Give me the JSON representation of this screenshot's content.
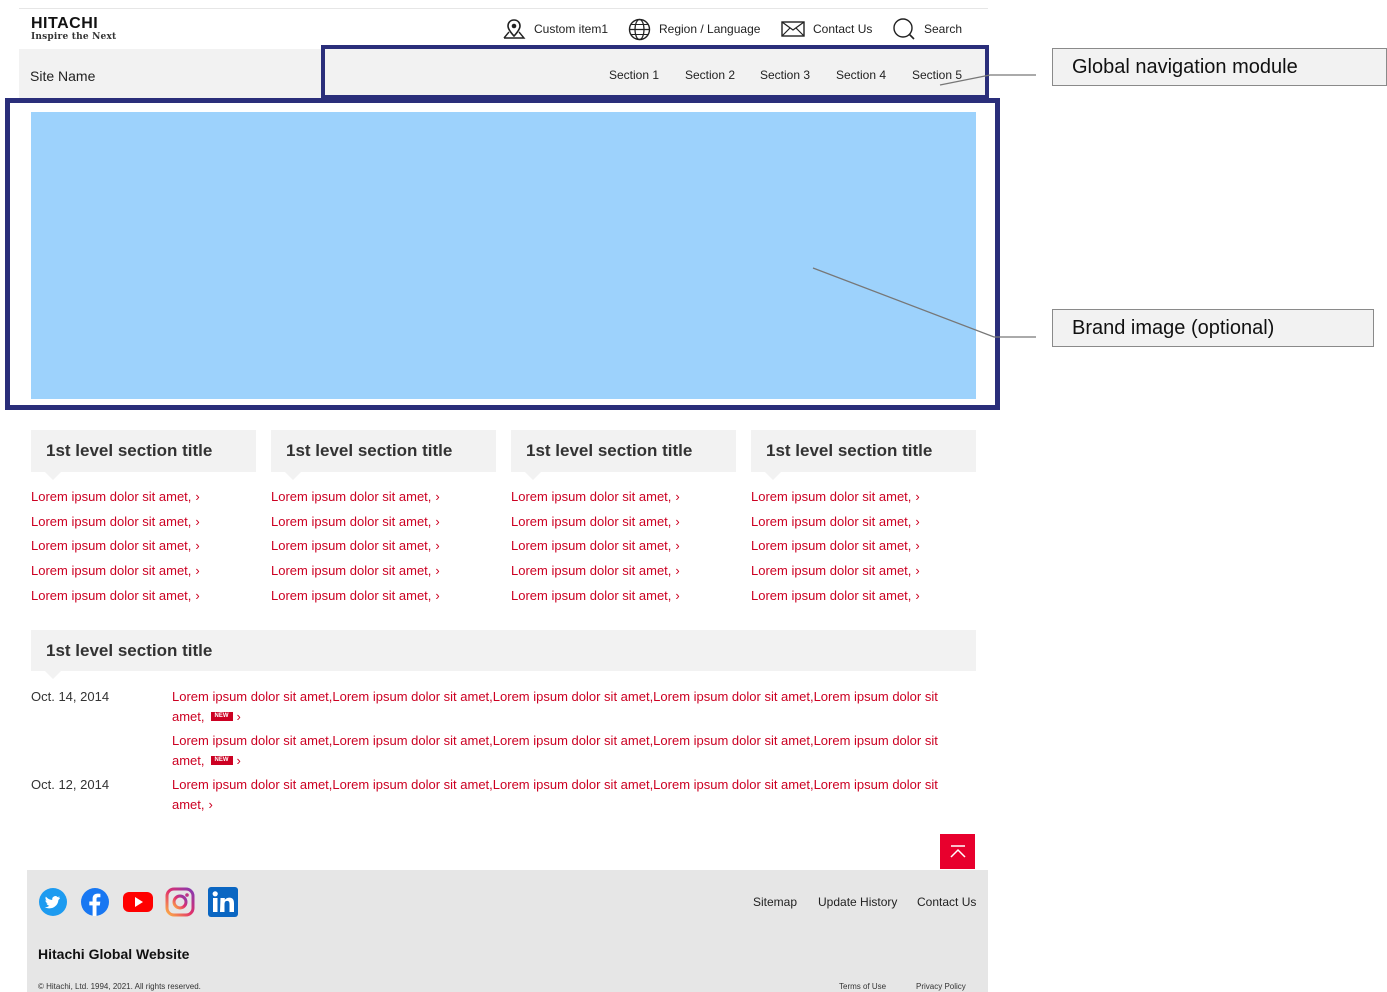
{
  "header": {
    "logo_main": "HITACHI",
    "logo_tagline": "Inspire the Next",
    "utility": {
      "custom_item": "Custom item1",
      "region_language": "Region / Language",
      "contact": "Contact Us",
      "search": "Search"
    },
    "site_name": "Site Name",
    "nav_sections": [
      "Section 1",
      "Section 2",
      "Section 3",
      "Section 4",
      "Section 5"
    ]
  },
  "annotations": {
    "global_nav": "Global navigation module",
    "brand_image": "Brand image (optional)"
  },
  "link_sections": [
    {
      "title": "1st level section title",
      "links": [
        "Lorem ipsum dolor sit amet,",
        "Lorem ipsum dolor sit amet,",
        "Lorem ipsum dolor sit amet,",
        "Lorem ipsum dolor sit amet,",
        "Lorem ipsum dolor sit amet,"
      ]
    },
    {
      "title": "1st level section title",
      "links": [
        "Lorem ipsum dolor sit amet,",
        "Lorem ipsum dolor sit amet,",
        "Lorem ipsum dolor sit amet,",
        "Lorem ipsum dolor sit amet,",
        "Lorem ipsum dolor sit amet,"
      ]
    },
    {
      "title": "1st level section title",
      "links": [
        "Lorem ipsum dolor sit amet,",
        "Lorem ipsum dolor sit amet,",
        "Lorem ipsum dolor sit amet,",
        "Lorem ipsum dolor sit amet,",
        "Lorem ipsum dolor sit amet,"
      ]
    },
    {
      "title": "1st level section title",
      "links": [
        "Lorem ipsum dolor sit amet,",
        "Lorem ipsum dolor sit amet,",
        "Lorem ipsum dolor sit amet,",
        "Lorem ipsum dolor sit amet,",
        "Lorem ipsum dolor sit amet,"
      ]
    }
  ],
  "news": {
    "title": "1st level section title",
    "items": [
      {
        "date": "Oct. 14, 2014",
        "text": "Lorem ipsum dolor sit amet,Lorem ipsum dolor sit amet,Lorem ipsum dolor sit amet,Lorem ipsum dolor sit amet,Lorem ipsum dolor sit amet,",
        "badge": "NEW"
      },
      {
        "date": "",
        "text": "Lorem ipsum dolor sit amet,Lorem ipsum dolor sit amet,Lorem ipsum dolor sit amet,Lorem ipsum dolor sit amet,Lorem ipsum dolor sit amet,",
        "badge": "NEW"
      },
      {
        "date": "Oct. 12, 2014",
        "text": "Lorem ipsum dolor sit amet,Lorem ipsum dolor sit amet,Lorem ipsum dolor sit amet,Lorem ipsum dolor sit amet,Lorem ipsum dolor sit amet,",
        "badge": ""
      }
    ]
  },
  "footer": {
    "social_icons": [
      "twitter-icon",
      "facebook-icon",
      "youtube-icon",
      "instagram-icon",
      "linkedin-icon"
    ],
    "links": [
      "Sitemap",
      "Update History",
      "Contact Us"
    ],
    "site_title": "Hitachi Global Website",
    "copyright": "© Hitachi, Ltd. 1994, 2021. All rights reserved.",
    "legal_links": [
      "Terms of Use",
      "Privacy Policy"
    ]
  },
  "colors": {
    "accent_red": "#cc0022",
    "annotation_border": "#2a2e7a",
    "brand_placeholder": "#9dd2fc"
  }
}
